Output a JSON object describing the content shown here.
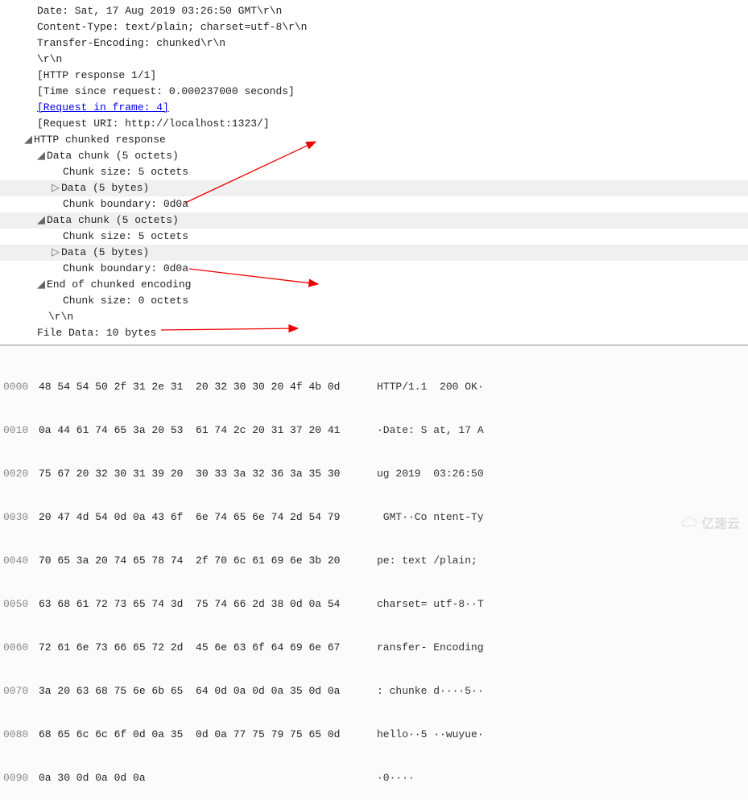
{
  "packet": {
    "date": "Date: Sat, 17 Aug 2019 03:26:50 GMT\\r\\n",
    "contentType": "Content-Type: text/plain; charset=utf-8\\r\\n",
    "transferEnc": "Transfer-Encoding: chunked\\r\\n",
    "crlf": "\\r\\n",
    "httpResp": "[HTTP response 1/1]",
    "timeSince": "[Time since request: 0.000237000 seconds]",
    "reqFrame": "[Request in frame: 4]",
    "reqUri": "[Request URI: http://localhost:1323/]",
    "chunkedResp": "HTTP chunked response",
    "chunk1": {
      "label": "Data chunk (5 octets)",
      "size": "Chunk size: 5 octets",
      "data": "Data (5 bytes)",
      "boundary": "Chunk boundary: 0d0a"
    },
    "chunk2": {
      "label": "Data chunk (5 octets)",
      "size": "Chunk size: 5 octets",
      "data": "Data (5 bytes)",
      "boundary": "Chunk boundary: 0d0a"
    },
    "endChunk": {
      "label": "End of chunked encoding",
      "size": "Chunk size: 0 octets"
    },
    "trailCrlf": "\\r\\n",
    "fileData": "File Data: 10 bytes"
  },
  "hex": [
    {
      "off": "0000",
      "bytes": "48 54 54 50 2f 31 2e 31  20 32 30 30 20 4f 4b 0d",
      "ascii": "HTTP/1.1  200 OK·"
    },
    {
      "off": "0010",
      "bytes": "0a 44 61 74 65 3a 20 53  61 74 2c 20 31 37 20 41",
      "ascii": "·Date: S at, 17 A"
    },
    {
      "off": "0020",
      "bytes": "75 67 20 32 30 31 39 20  30 33 3a 32 36 3a 35 30",
      "ascii": "ug 2019  03:26:50"
    },
    {
      "off": "0030",
      "bytes": "20 47 4d 54 0d 0a 43 6f  6e 74 65 6e 74 2d 54 79",
      "ascii": " GMT··Co ntent-Ty"
    },
    {
      "off": "0040",
      "bytes": "70 65 3a 20 74 65 78 74  2f 70 6c 61 69 6e 3b 20",
      "ascii": "pe: text /plain; "
    },
    {
      "off": "0050",
      "bytes": "63 68 61 72 73 65 74 3d  75 74 66 2d 38 0d 0a 54",
      "ascii": "charset= utf-8··T"
    },
    {
      "off": "0060",
      "bytes": "72 61 6e 73 66 65 72 2d  45 6e 63 6f 64 69 6e 67",
      "ascii": "ransfer- Encoding"
    },
    {
      "off": "0070",
      "bytes": "3a 20 63 68 75 6e 6b 65  64 0d 0a 0d 0a 35 0d 0a",
      "ascii": ": chunke d····5··"
    },
    {
      "off": "0080",
      "bytes": "68 65 6c 6c 6f 0d 0a 35  0d 0a 77 75 79 75 65 0d",
      "ascii": "hello··5 ··wuyue·"
    },
    {
      "off": "0090",
      "bytes": "0a 30 0d 0a 0d 0a",
      "ascii": "·0····"
    }
  ],
  "watermark": "亿速云"
}
